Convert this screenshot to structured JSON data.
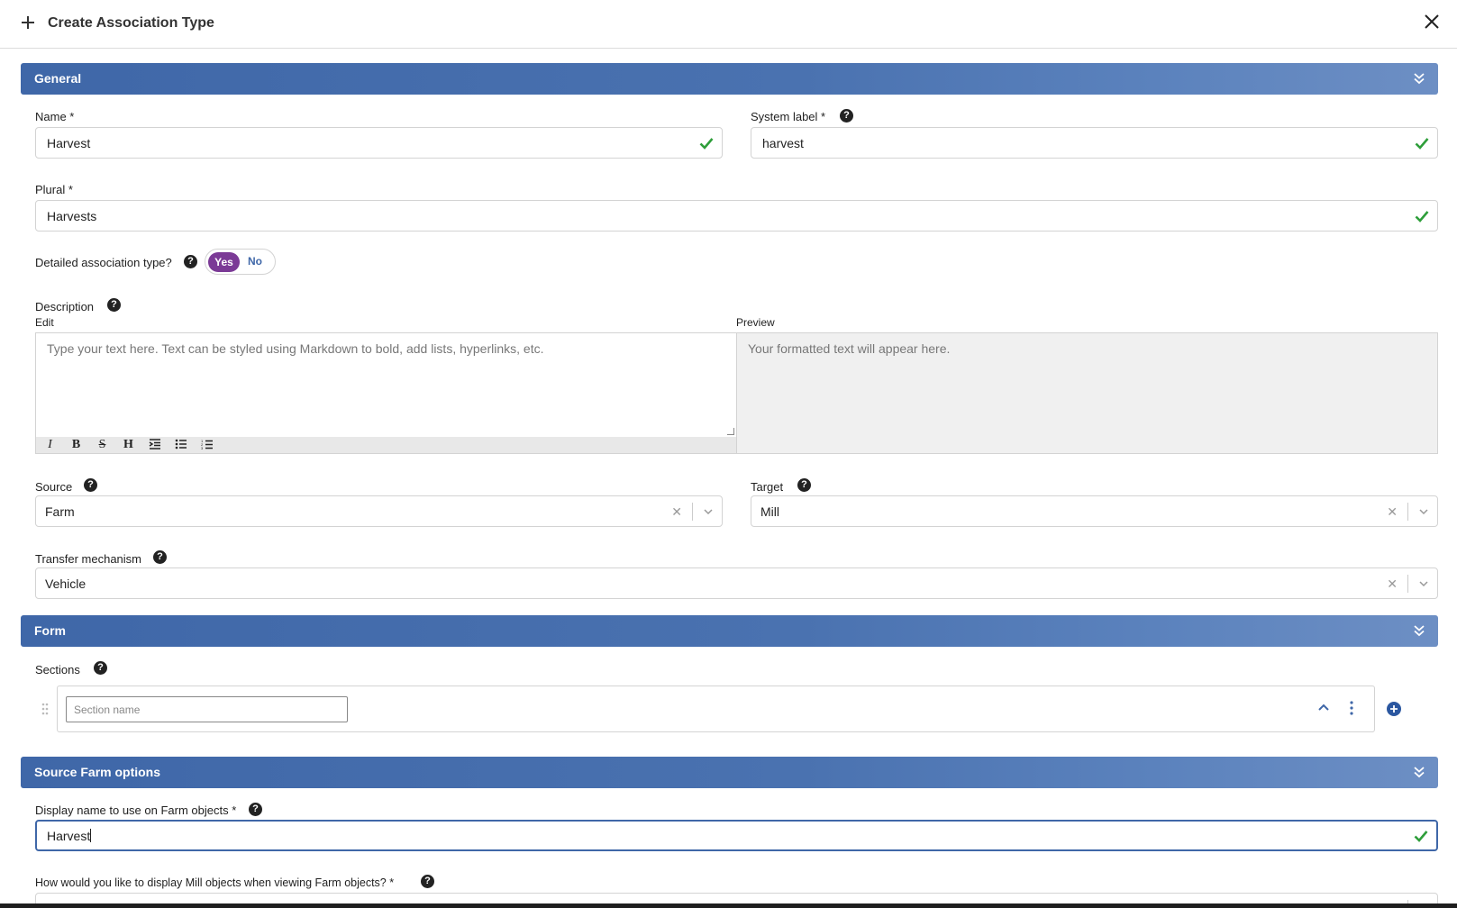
{
  "dialog": {
    "title": "Create Association Type"
  },
  "general": {
    "header": "General",
    "name": {
      "label": "Name *",
      "value": "Harvest"
    },
    "system_label": {
      "label": "System label *",
      "value": "harvest"
    },
    "plural": {
      "label": "Plural *",
      "value": "Harvests"
    },
    "detailed": {
      "label": "Detailed association type?",
      "yes": "Yes",
      "no": "No",
      "selected": "Yes"
    },
    "description": {
      "label": "Description",
      "edit_label": "Edit",
      "preview_label": "Preview",
      "placeholder": "Type your text here. Text can be styled using Markdown to bold, add lists, hyperlinks, etc.",
      "preview_placeholder": "Your formatted text will appear here.",
      "toolbar": [
        "I",
        "B",
        "S",
        "H",
        "indent",
        "ul",
        "ol"
      ]
    },
    "source": {
      "label": "Source",
      "value": "Farm"
    },
    "target": {
      "label": "Target",
      "value": "Mill"
    },
    "transfer": {
      "label": "Transfer mechanism",
      "value": "Vehicle"
    }
  },
  "form": {
    "header": "Form",
    "sections_label": "Sections",
    "section_name_placeholder": "Section name"
  },
  "source_options": {
    "header": "Source Farm options",
    "display_name": {
      "label": "Display name to use on Farm objects *",
      "value": "Harvest"
    },
    "display_mode": {
      "label": "How would you like to display Mill objects when viewing Farm objects? *"
    }
  },
  "colors": {
    "accent": "#3f67a8",
    "toggle_active": "#7b3a96",
    "valid": "#2e9e3a"
  },
  "help_glyph": "?"
}
